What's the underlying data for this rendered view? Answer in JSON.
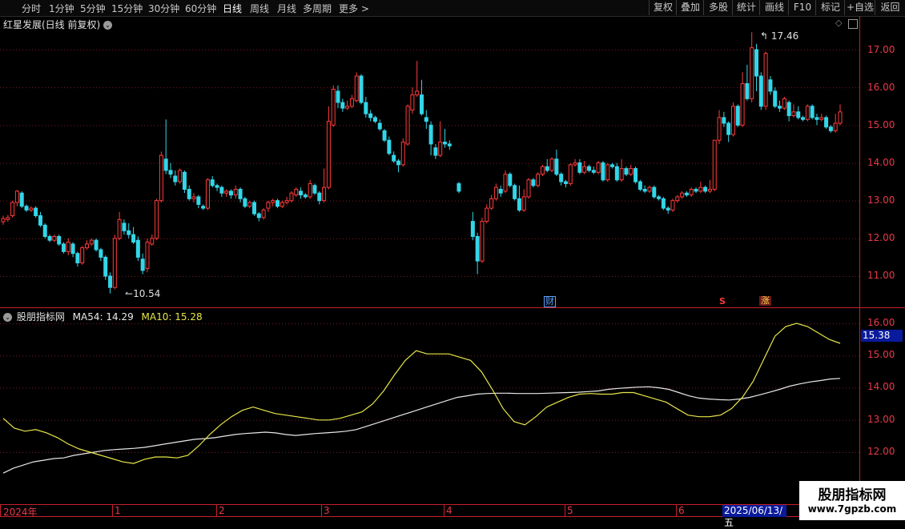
{
  "toolbar": {
    "periods": [
      "分时",
      "1分钟",
      "5分钟",
      "15分钟",
      "30分钟",
      "60分钟",
      "日线",
      "周线",
      "月线",
      "多周期",
      "更多 >"
    ],
    "active_period": "日线",
    "tools": [
      "复权",
      "叠加",
      "多股",
      "统计",
      "画线",
      "F10",
      "标记",
      "+自选",
      "返回"
    ]
  },
  "header": {
    "title": "红星发展(日线 前复权)"
  },
  "main_axis": {
    "labels": [
      "17.00",
      "16.00",
      "15.00",
      "14.00",
      "13.00",
      "12.00",
      "11.00"
    ]
  },
  "annotations": {
    "high_label": "17.46",
    "low_label": "10.54",
    "marker_cai": "财",
    "marker_s": "S",
    "marker_zhang": "涨"
  },
  "indicator": {
    "name": "股朋指标网",
    "ma54_label": "MA54: 14.29",
    "ma10_label": "MA10: 15.28",
    "axis_labels": [
      "16.00",
      "15.00",
      "14.00",
      "13.00",
      "12.00"
    ],
    "current_value": "15.38"
  },
  "xaxis": {
    "labels": [
      "2024年",
      "1",
      "2",
      "3",
      "4",
      "5",
      "6"
    ],
    "cursor_date": "2025/06/13/五"
  },
  "watermark": {
    "title": "股朋指标网",
    "url": "www.7gpzb.com"
  },
  "colors": {
    "up": "#ff3b3b",
    "down": "#33d6e8",
    "ma54": "#e8e8e8",
    "ma10": "#e6e64a",
    "axis": "#c8202a"
  },
  "chart_data": {
    "type": "candlestick",
    "ylim": [
      10.4,
      17.7
    ],
    "candles": [
      [
        12.44,
        12.52,
        12.36,
        12.6
      ],
      [
        12.5,
        12.55,
        12.44,
        12.62
      ],
      [
        12.6,
        12.95,
        12.55,
        13.0
      ],
      [
        12.95,
        13.25,
        12.85,
        13.28
      ],
      [
        13.2,
        12.85,
        12.8,
        13.25
      ],
      [
        12.85,
        12.75,
        12.7,
        12.9
      ],
      [
        12.75,
        12.8,
        12.7,
        12.85
      ],
      [
        12.8,
        12.6,
        12.55,
        12.85
      ],
      [
        12.6,
        12.35,
        12.3,
        12.7
      ],
      [
        12.35,
        12.05,
        12.0,
        12.4
      ],
      [
        12.05,
        11.95,
        11.9,
        12.1
      ],
      [
        11.95,
        12.05,
        11.9,
        12.1
      ],
      [
        12.05,
        11.85,
        11.8,
        12.1
      ],
      [
        11.85,
        11.65,
        11.6,
        11.9
      ],
      [
        11.65,
        11.9,
        11.55,
        12.0
      ],
      [
        11.85,
        11.6,
        11.5,
        11.9
      ],
      [
        11.6,
        11.35,
        11.25,
        11.65
      ],
      [
        11.35,
        11.75,
        11.3,
        11.8
      ],
      [
        11.75,
        11.85,
        11.7,
        11.95
      ],
      [
        11.85,
        11.95,
        11.8,
        12.0
      ],
      [
        11.95,
        11.7,
        11.65,
        12.0
      ],
      [
        11.7,
        11.5,
        11.4,
        11.75
      ],
      [
        11.5,
        11.0,
        10.9,
        11.55
      ],
      [
        11.0,
        10.7,
        10.54,
        11.1
      ],
      [
        10.7,
        12.0,
        10.65,
        12.1
      ],
      [
        12.0,
        12.5,
        11.95,
        12.7
      ],
      [
        12.4,
        12.2,
        12.1,
        12.5
      ],
      [
        12.2,
        12.1,
        12.0,
        12.4
      ],
      [
        12.1,
        11.9,
        11.85,
        12.3
      ],
      [
        11.95,
        11.5,
        11.4,
        12.05
      ],
      [
        11.45,
        11.15,
        11.05,
        11.6
      ],
      [
        11.2,
        11.9,
        11.1,
        12.0
      ],
      [
        11.85,
        12.0,
        11.8,
        12.1
      ],
      [
        12.0,
        13.0,
        11.95,
        13.05
      ],
      [
        13.0,
        14.2,
        12.95,
        14.3
      ],
      [
        14.1,
        13.8,
        13.7,
        15.15
      ],
      [
        13.8,
        13.7,
        13.6,
        14.0
      ],
      [
        13.65,
        13.5,
        13.4,
        13.8
      ],
      [
        13.5,
        13.8,
        13.45,
        13.85
      ],
      [
        13.75,
        13.3,
        13.2,
        13.8
      ],
      [
        13.3,
        13.05,
        13.0,
        13.4
      ],
      [
        13.05,
        13.1,
        12.95,
        13.2
      ],
      [
        13.1,
        12.9,
        12.8,
        13.15
      ],
      [
        12.85,
        12.8,
        12.75,
        12.9
      ],
      [
        12.8,
        13.55,
        12.75,
        13.6
      ],
      [
        13.55,
        13.4,
        13.35,
        13.65
      ],
      [
        13.4,
        13.35,
        13.25,
        13.45
      ],
      [
        13.35,
        13.2,
        13.1,
        13.4
      ],
      [
        13.2,
        13.25,
        13.1,
        13.3
      ],
      [
        13.25,
        13.15,
        13.05,
        13.3
      ],
      [
        13.15,
        13.3,
        13.05,
        13.4
      ],
      [
        13.3,
        13.05,
        12.95,
        13.35
      ],
      [
        13.05,
        12.85,
        12.8,
        13.1
      ],
      [
        12.85,
        12.95,
        12.8,
        13.0
      ],
      [
        12.95,
        12.65,
        12.6,
        13.0
      ],
      [
        12.65,
        12.55,
        12.45,
        12.7
      ],
      [
        12.55,
        12.75,
        12.5,
        12.8
      ],
      [
        12.8,
        12.95,
        12.7,
        13.0
      ],
      [
        12.95,
        13.0,
        12.85,
        13.05
      ],
      [
        13.0,
        12.85,
        12.8,
        13.05
      ],
      [
        12.85,
        12.95,
        12.8,
        13.0
      ],
      [
        12.95,
        13.0,
        12.9,
        13.1
      ],
      [
        13.0,
        13.2,
        12.95,
        13.25
      ],
      [
        13.15,
        13.3,
        13.1,
        13.35
      ],
      [
        13.25,
        13.15,
        13.05,
        13.35
      ],
      [
        13.15,
        13.1,
        13.05,
        13.2
      ],
      [
        13.1,
        13.45,
        13.05,
        13.55
      ],
      [
        13.4,
        13.2,
        13.15,
        13.45
      ],
      [
        13.2,
        13.0,
        12.9,
        13.25
      ],
      [
        13.0,
        13.35,
        12.95,
        13.85
      ],
      [
        13.35,
        15.1,
        13.3,
        15.5
      ],
      [
        15.0,
        15.95,
        14.95,
        16.05
      ],
      [
        15.9,
        15.6,
        15.45,
        16.05
      ],
      [
        15.6,
        15.45,
        15.35,
        15.7
      ],
      [
        15.45,
        15.5,
        15.4,
        15.65
      ],
      [
        15.5,
        15.7,
        15.45,
        15.8
      ],
      [
        15.65,
        16.3,
        15.6,
        16.4
      ],
      [
        16.3,
        15.6,
        15.55,
        16.35
      ],
      [
        15.6,
        15.3,
        15.2,
        15.75
      ],
      [
        15.3,
        15.2,
        15.1,
        15.4
      ],
      [
        15.2,
        15.1,
        15.05,
        15.25
      ],
      [
        15.05,
        14.9,
        14.85,
        15.15
      ],
      [
        14.85,
        14.6,
        14.55,
        14.9
      ],
      [
        14.6,
        14.25,
        14.2,
        14.7
      ],
      [
        14.2,
        14.05,
        14.0,
        14.3
      ],
      [
        14.05,
        13.95,
        13.75,
        14.1
      ],
      [
        13.95,
        14.55,
        13.9,
        14.65
      ],
      [
        14.5,
        15.5,
        14.45,
        15.55
      ],
      [
        15.4,
        15.8,
        15.3,
        16.0
      ],
      [
        15.8,
        15.9,
        15.75,
        16.7
      ],
      [
        15.8,
        15.3,
        15.25,
        16.2
      ],
      [
        15.2,
        15.1,
        14.9,
        15.4
      ],
      [
        15.0,
        14.5,
        14.2,
        15.1
      ],
      [
        14.4,
        14.2,
        14.1,
        14.5
      ],
      [
        14.2,
        14.55,
        14.15,
        15.1
      ],
      [
        14.55,
        14.5,
        14.4,
        14.9
      ],
      [
        14.5,
        14.45,
        14.35,
        14.6
      ],
      [
        null,
        null,
        null,
        null
      ],
      [
        13.45,
        13.25,
        13.2,
        13.5
      ],
      [
        null,
        null,
        null,
        null
      ],
      [
        null,
        null,
        null,
        null
      ],
      [
        12.45,
        12.05,
        11.95,
        12.7
      ],
      [
        12.05,
        11.4,
        11.05,
        12.15
      ],
      [
        11.4,
        12.45,
        11.35,
        12.55
      ],
      [
        12.45,
        12.8,
        12.4,
        12.9
      ],
      [
        12.8,
        13.05,
        12.75,
        13.15
      ],
      [
        13.05,
        13.35,
        13.0,
        13.45
      ],
      [
        13.3,
        13.2,
        13.1,
        13.4
      ],
      [
        13.25,
        13.7,
        13.2,
        13.8
      ],
      [
        13.7,
        13.4,
        13.35,
        13.75
      ],
      [
        13.4,
        13.05,
        13.0,
        13.45
      ],
      [
        13.05,
        12.75,
        12.7,
        13.4
      ],
      [
        12.75,
        13.1,
        12.7,
        13.3
      ],
      [
        13.1,
        13.55,
        13.05,
        13.6
      ],
      [
        13.55,
        13.4,
        13.35,
        13.6
      ],
      [
        13.4,
        13.7,
        13.35,
        13.75
      ],
      [
        13.7,
        13.9,
        13.65,
        13.95
      ],
      [
        13.9,
        13.8,
        13.75,
        14.1
      ],
      [
        13.8,
        14.1,
        13.75,
        14.15
      ],
      [
        14.1,
        13.7,
        13.65,
        14.35
      ],
      [
        13.7,
        13.5,
        13.4,
        13.75
      ],
      [
        13.5,
        13.45,
        13.35,
        13.55
      ],
      [
        13.45,
        13.95,
        13.4,
        14.0
      ],
      [
        13.95,
        14.0,
        13.9,
        14.1
      ],
      [
        14.0,
        13.75,
        13.7,
        14.1
      ],
      [
        13.75,
        13.9,
        13.7,
        14.05
      ],
      [
        13.9,
        13.8,
        13.75,
        13.95
      ],
      [
        13.8,
        13.75,
        13.7,
        13.9
      ],
      [
        13.75,
        14.0,
        13.7,
        14.05
      ],
      [
        14.0,
        13.55,
        13.5,
        14.05
      ],
      [
        13.55,
        13.95,
        13.5,
        14.0
      ],
      [
        13.95,
        13.9,
        13.85,
        14.0
      ],
      [
        13.9,
        13.55,
        13.5,
        14.0
      ],
      [
        13.55,
        13.85,
        13.5,
        14.1
      ],
      [
        13.85,
        13.7,
        13.65,
        13.9
      ],
      [
        13.7,
        13.85,
        13.65,
        13.95
      ],
      [
        13.85,
        13.5,
        13.45,
        13.9
      ],
      [
        13.5,
        13.3,
        13.25,
        13.55
      ],
      [
        13.3,
        13.25,
        13.2,
        13.4
      ],
      [
        13.25,
        13.35,
        13.2,
        13.4
      ],
      [
        13.35,
        13.1,
        13.05,
        13.4
      ],
      [
        13.1,
        13.05,
        13.0,
        13.15
      ],
      [
        13.05,
        12.8,
        12.75,
        13.1
      ],
      [
        12.8,
        12.75,
        12.65,
        12.85
      ],
      [
        12.75,
        13.0,
        12.7,
        13.05
      ],
      [
        13.0,
        13.1,
        12.95,
        13.15
      ],
      [
        13.1,
        13.2,
        13.05,
        13.25
      ],
      [
        13.2,
        13.15,
        13.1,
        13.25
      ],
      [
        13.15,
        13.3,
        13.1,
        13.35
      ],
      [
        13.3,
        13.25,
        13.2,
        13.35
      ],
      [
        13.25,
        13.35,
        13.2,
        13.5
      ],
      [
        13.35,
        13.25,
        13.2,
        13.4
      ],
      [
        13.25,
        13.3,
        13.2,
        13.55
      ],
      [
        13.3,
        14.6,
        13.25,
        14.6
      ],
      [
        14.6,
        15.2,
        14.5,
        15.4
      ],
      [
        15.2,
        15.05,
        14.95,
        15.35
      ],
      [
        15.05,
        14.75,
        14.55,
        15.1
      ],
      [
        14.75,
        15.5,
        14.7,
        15.6
      ],
      [
        15.5,
        15.0,
        14.95,
        15.55
      ],
      [
        15.0,
        16.1,
        14.95,
        16.4
      ],
      [
        16.1,
        15.7,
        15.65,
        16.6
      ],
      [
        15.7,
        17.05,
        15.6,
        17.46
      ],
      [
        17.0,
        16.3,
        15.9,
        17.15
      ],
      [
        16.3,
        15.5,
        15.4,
        16.4
      ],
      [
        15.5,
        16.9,
        15.4,
        16.95
      ],
      [
        16.2,
        15.9,
        15.8,
        16.3
      ],
      [
        15.9,
        15.5,
        15.45,
        16.0
      ],
      [
        15.5,
        15.45,
        15.35,
        15.65
      ],
      [
        15.45,
        15.7,
        15.4,
        15.75
      ],
      [
        15.6,
        15.25,
        15.1,
        15.65
      ],
      [
        15.25,
        15.35,
        15.2,
        15.55
      ],
      [
        15.35,
        15.2,
        15.15,
        15.5
      ],
      [
        15.2,
        15.15,
        15.1,
        15.25
      ],
      [
        15.15,
        15.5,
        15.1,
        15.55
      ],
      [
        15.5,
        15.2,
        15.15,
        15.55
      ],
      [
        15.2,
        15.15,
        15.0,
        15.3
      ],
      [
        15.15,
        15.2,
        15.1,
        15.3
      ],
      [
        15.2,
        14.95,
        14.9,
        15.25
      ],
      [
        14.95,
        14.85,
        14.8,
        15.0
      ],
      [
        14.85,
        15.05,
        14.8,
        15.3
      ],
      [
        15.05,
        15.35,
        15.0,
        15.55
      ]
    ],
    "indicator_ylim": [
      11.1,
      16.6
    ],
    "ma54": [
      11.35,
      11.5,
      11.6,
      11.7,
      11.75,
      11.8,
      11.82,
      11.9,
      11.95,
      12.0,
      12.05,
      12.08,
      12.1,
      12.12,
      12.15,
      12.2,
      12.25,
      12.3,
      12.35,
      12.4,
      12.42,
      12.45,
      12.5,
      12.55,
      12.58,
      12.6,
      12.62,
      12.6,
      12.55,
      12.52,
      12.55,
      12.58,
      12.6,
      12.62,
      12.65,
      12.7,
      12.8,
      12.9,
      13.0,
      13.1,
      13.2,
      13.3,
      13.4,
      13.5,
      13.6,
      13.7,
      13.75,
      13.8,
      13.82,
      13.83,
      13.83,
      13.82,
      13.82,
      13.82,
      13.83,
      13.84,
      13.85,
      13.86,
      13.88,
      13.9,
      13.95,
      13.98,
      14.0,
      14.02,
      14.03,
      14.0,
      13.95,
      13.85,
      13.75,
      13.68,
      13.65,
      13.63,
      13.62,
      13.65,
      13.7,
      13.78,
      13.86,
      13.95,
      14.05,
      14.12,
      14.18,
      14.22,
      14.27,
      14.29
    ],
    "ma10": [
      13.05,
      12.75,
      12.65,
      12.7,
      12.6,
      12.45,
      12.25,
      12.1,
      12.0,
      11.9,
      11.8,
      11.7,
      11.65,
      11.78,
      11.85,
      11.85,
      11.82,
      11.9,
      12.2,
      12.55,
      12.85,
      13.1,
      13.3,
      13.4,
      13.3,
      13.2,
      13.15,
      13.1,
      13.05,
      13.0,
      13.0,
      13.05,
      13.15,
      13.25,
      13.5,
      13.9,
      14.4,
      14.85,
      15.15,
      15.05,
      15.05,
      15.05,
      14.95,
      14.85,
      14.5,
      13.95,
      13.35,
      12.95,
      12.85,
      13.1,
      13.4,
      13.55,
      13.7,
      13.8,
      13.82,
      13.8,
      13.8,
      13.85,
      13.85,
      13.75,
      13.65,
      13.55,
      13.35,
      13.15,
      13.1,
      13.1,
      13.15,
      13.35,
      13.7,
      14.2,
      14.9,
      15.6,
      15.9,
      16.0,
      15.9,
      15.7,
      15.5,
      15.38
    ],
    "annotations": [
      "17.46",
      "10.54"
    ]
  }
}
